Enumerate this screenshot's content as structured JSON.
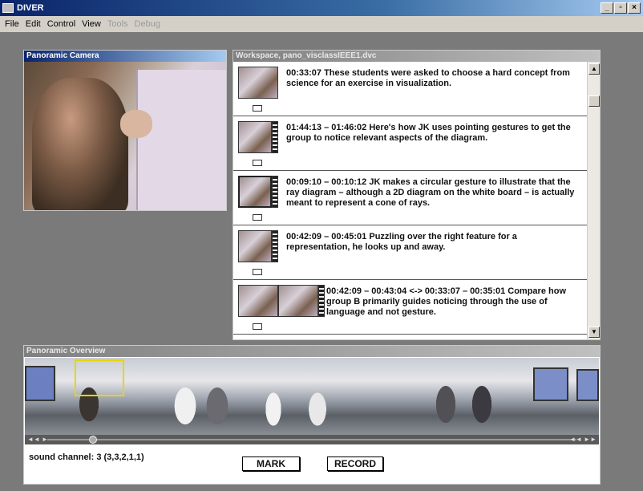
{
  "window": {
    "title": "DIVER",
    "minimize": "_",
    "maximize": "▫",
    "close": "×"
  },
  "menu": [
    {
      "label": "File",
      "enabled": true
    },
    {
      "label": "Edit",
      "enabled": true
    },
    {
      "label": "Control",
      "enabled": true
    },
    {
      "label": "View",
      "enabled": true
    },
    {
      "label": "Tools",
      "enabled": false
    },
    {
      "label": "Debug",
      "enabled": false
    }
  ],
  "camera": {
    "title": "Panoramic Camera"
  },
  "workspace": {
    "title": "Workspace, pano_visclassIEEE1.dvc",
    "scroll_up": "▲",
    "scroll_down": "▼",
    "entries": [
      {
        "text": "00:33:07  These students were asked to choose a hard concept from science for an exercise in visualization."
      },
      {
        "text": "01:44:13 – 01:46:02  Here's how JK uses pointing gestures to get the group to notice relevant aspects of the diagram."
      },
      {
        "text": "00:09:10 – 00:10:12  JK makes a circular gesture to illustrate that the ray diagram – although a 2D diagram on the white board –  is actually meant to represent a cone of rays."
      },
      {
        "text": "00:42:09 – 00:45:01 Puzzling over the right feature for a representation, he looks up and away."
      },
      {
        "text": "00:42:09 – 00:43:04 <-> 00:33:07 – 00:35:01 Compare how group B primarily guides noticing through the use of language and not gesture."
      }
    ]
  },
  "overview": {
    "title": "Panoramic Overview",
    "sound_channel": "sound channel: 3 (3,3,2,1,1)",
    "mark_label": "MARK",
    "record_label": "RECORD",
    "rewind": "◄◄ ►",
    "forward": "◄◄ ►►"
  },
  "colors": {
    "roi_box": "#e8d400",
    "active_title": "#0a246a"
  }
}
